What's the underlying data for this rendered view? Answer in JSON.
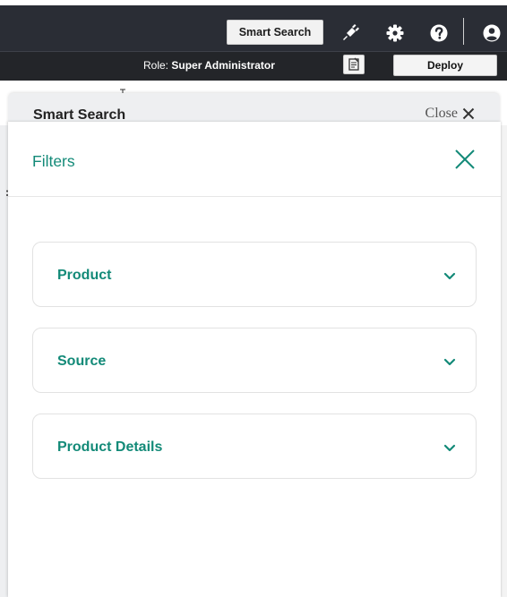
{
  "topbar": {
    "smart_search_label": "Smart Search",
    "icons": [
      "plug-icon",
      "gear-icon",
      "help-icon",
      "user-icon"
    ]
  },
  "rolebar": {
    "role_label": "Role:",
    "role_value": "Super Administrator",
    "notes_icon": "notes-icon",
    "deploy_label": "Deploy"
  },
  "smart_search": {
    "title": "Smart Search",
    "close_label": "Close"
  },
  "filters": {
    "title": "Filters",
    "sections": [
      {
        "label": "Product"
      },
      {
        "label": "Source"
      },
      {
        "label": "Product Details"
      }
    ]
  },
  "colors": {
    "accent": "#138a78",
    "topbar": "#2a2d35",
    "rolebar": "#232529"
  }
}
